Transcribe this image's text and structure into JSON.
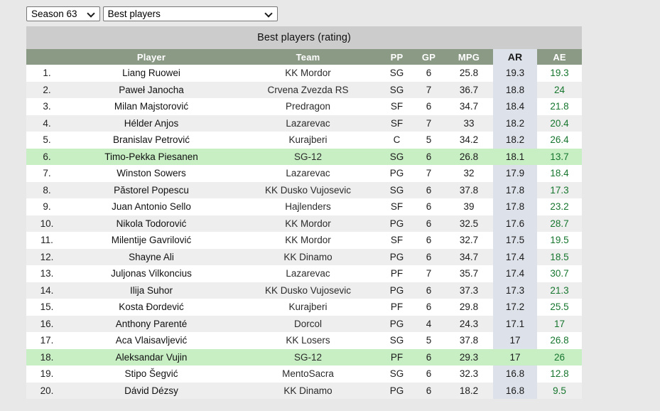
{
  "controls": {
    "season_select": {
      "value": "Season 63",
      "icon": "chevron-down-icon"
    },
    "view_select": {
      "value": "Best players",
      "icon": "chevron-down-icon"
    }
  },
  "table": {
    "title": "Best players (rating)",
    "columns": {
      "rank": "",
      "player": "Player",
      "team": "Team",
      "pp": "PP",
      "gp": "GP",
      "mpg": "MPG",
      "ar": "AR",
      "ae": "AE"
    },
    "highlight_team": "SG-12",
    "colors": {
      "header_green": "#8a9a85",
      "title_gray": "#cccccc",
      "ar_column": "#dde1e9",
      "highlight_row": "#c8eec4",
      "ae_text": "#16762e",
      "page_bg": "#e8e8e8"
    },
    "rows": [
      {
        "rank": "1.",
        "player": "Liang Ruowei",
        "team": "KK Mordor",
        "pp": "SG",
        "gp": "6",
        "mpg": "25.8",
        "ar": "19.3",
        "ae": "19.3",
        "highlight": false
      },
      {
        "rank": "2.",
        "player": "Paweł Janocha",
        "team": "Crvena Zvezda RS",
        "pp": "SG",
        "gp": "7",
        "mpg": "36.7",
        "ar": "18.8",
        "ae": "24",
        "highlight": false
      },
      {
        "rank": "3.",
        "player": "Milan Majstorović",
        "team": "Predragon",
        "pp": "SF",
        "gp": "6",
        "mpg": "34.7",
        "ar": "18.4",
        "ae": "21.8",
        "highlight": false
      },
      {
        "rank": "4.",
        "player": "Hélder Anjos",
        "team": "Lazarevac",
        "pp": "SF",
        "gp": "7",
        "mpg": "33",
        "ar": "18.2",
        "ae": "20.4",
        "highlight": false
      },
      {
        "rank": "5.",
        "player": "Branislav Petrović",
        "team": "Kurajberi",
        "pp": "C",
        "gp": "5",
        "mpg": "34.2",
        "ar": "18.2",
        "ae": "26.4",
        "highlight": false
      },
      {
        "rank": "6.",
        "player": "Timo-Pekka Piesanen",
        "team": "SG-12",
        "pp": "SG",
        "gp": "6",
        "mpg": "26.8",
        "ar": "18.1",
        "ae": "13.7",
        "highlight": true
      },
      {
        "rank": "7.",
        "player": "Winston Sowers",
        "team": "Lazarevac",
        "pp": "PG",
        "gp": "7",
        "mpg": "32",
        "ar": "17.9",
        "ae": "18.4",
        "highlight": false
      },
      {
        "rank": "8.",
        "player": "Păstorel Popescu",
        "team": "KK Dusko Vujosevic",
        "pp": "SG",
        "gp": "6",
        "mpg": "37.8",
        "ar": "17.8",
        "ae": "17.3",
        "highlight": false
      },
      {
        "rank": "9.",
        "player": "Juan Antonio Sello",
        "team": "Hajlenders",
        "pp": "SF",
        "gp": "6",
        "mpg": "39",
        "ar": "17.8",
        "ae": "23.2",
        "highlight": false
      },
      {
        "rank": "10.",
        "player": "Nikola Todorović",
        "team": "KK Mordor",
        "pp": "PG",
        "gp": "6",
        "mpg": "32.5",
        "ar": "17.6",
        "ae": "28.7",
        "highlight": false
      },
      {
        "rank": "11.",
        "player": "Milentije Gavrilović",
        "team": "KK Mordor",
        "pp": "SF",
        "gp": "6",
        "mpg": "32.7",
        "ar": "17.5",
        "ae": "19.5",
        "highlight": false
      },
      {
        "rank": "12.",
        "player": "Shayne Ali",
        "team": "KK Dinamo",
        "pp": "PG",
        "gp": "6",
        "mpg": "34.7",
        "ar": "17.4",
        "ae": "18.5",
        "highlight": false
      },
      {
        "rank": "13.",
        "player": "Juljonas Vilkoncius",
        "team": "Lazarevac",
        "pp": "PF",
        "gp": "7",
        "mpg": "35.7",
        "ar": "17.4",
        "ae": "30.7",
        "highlight": false
      },
      {
        "rank": "14.",
        "player": "Ilija Suhor",
        "team": "KK Dusko Vujosevic",
        "pp": "PG",
        "gp": "6",
        "mpg": "37.3",
        "ar": "17.3",
        "ae": "21.3",
        "highlight": false
      },
      {
        "rank": "15.",
        "player": "Kosta Đordević",
        "team": "Kurajberi",
        "pp": "PF",
        "gp": "6",
        "mpg": "29.8",
        "ar": "17.2",
        "ae": "25.5",
        "highlight": false
      },
      {
        "rank": "16.",
        "player": "Anthony Parenté",
        "team": "Dorcol",
        "pp": "PG",
        "gp": "4",
        "mpg": "24.3",
        "ar": "17.1",
        "ae": "17",
        "highlight": false
      },
      {
        "rank": "17.",
        "player": "Aca Vlaisavljević",
        "team": "KK Losers",
        "pp": "SG",
        "gp": "5",
        "mpg": "37.8",
        "ar": "17",
        "ae": "26.8",
        "highlight": false
      },
      {
        "rank": "18.",
        "player": "Aleksandar Vujin",
        "team": "SG-12",
        "pp": "PF",
        "gp": "6",
        "mpg": "29.3",
        "ar": "17",
        "ae": "26",
        "highlight": true
      },
      {
        "rank": "19.",
        "player": "Stipo Šegvić",
        "team": "MentoSacra",
        "pp": "SG",
        "gp": "6",
        "mpg": "32.3",
        "ar": "16.8",
        "ae": "12.8",
        "highlight": false
      },
      {
        "rank": "20.",
        "player": "Dávid Dézsy",
        "team": "KK Dinamo",
        "pp": "PG",
        "gp": "6",
        "mpg": "18.2",
        "ar": "16.8",
        "ae": "9.5",
        "highlight": false
      }
    ]
  }
}
